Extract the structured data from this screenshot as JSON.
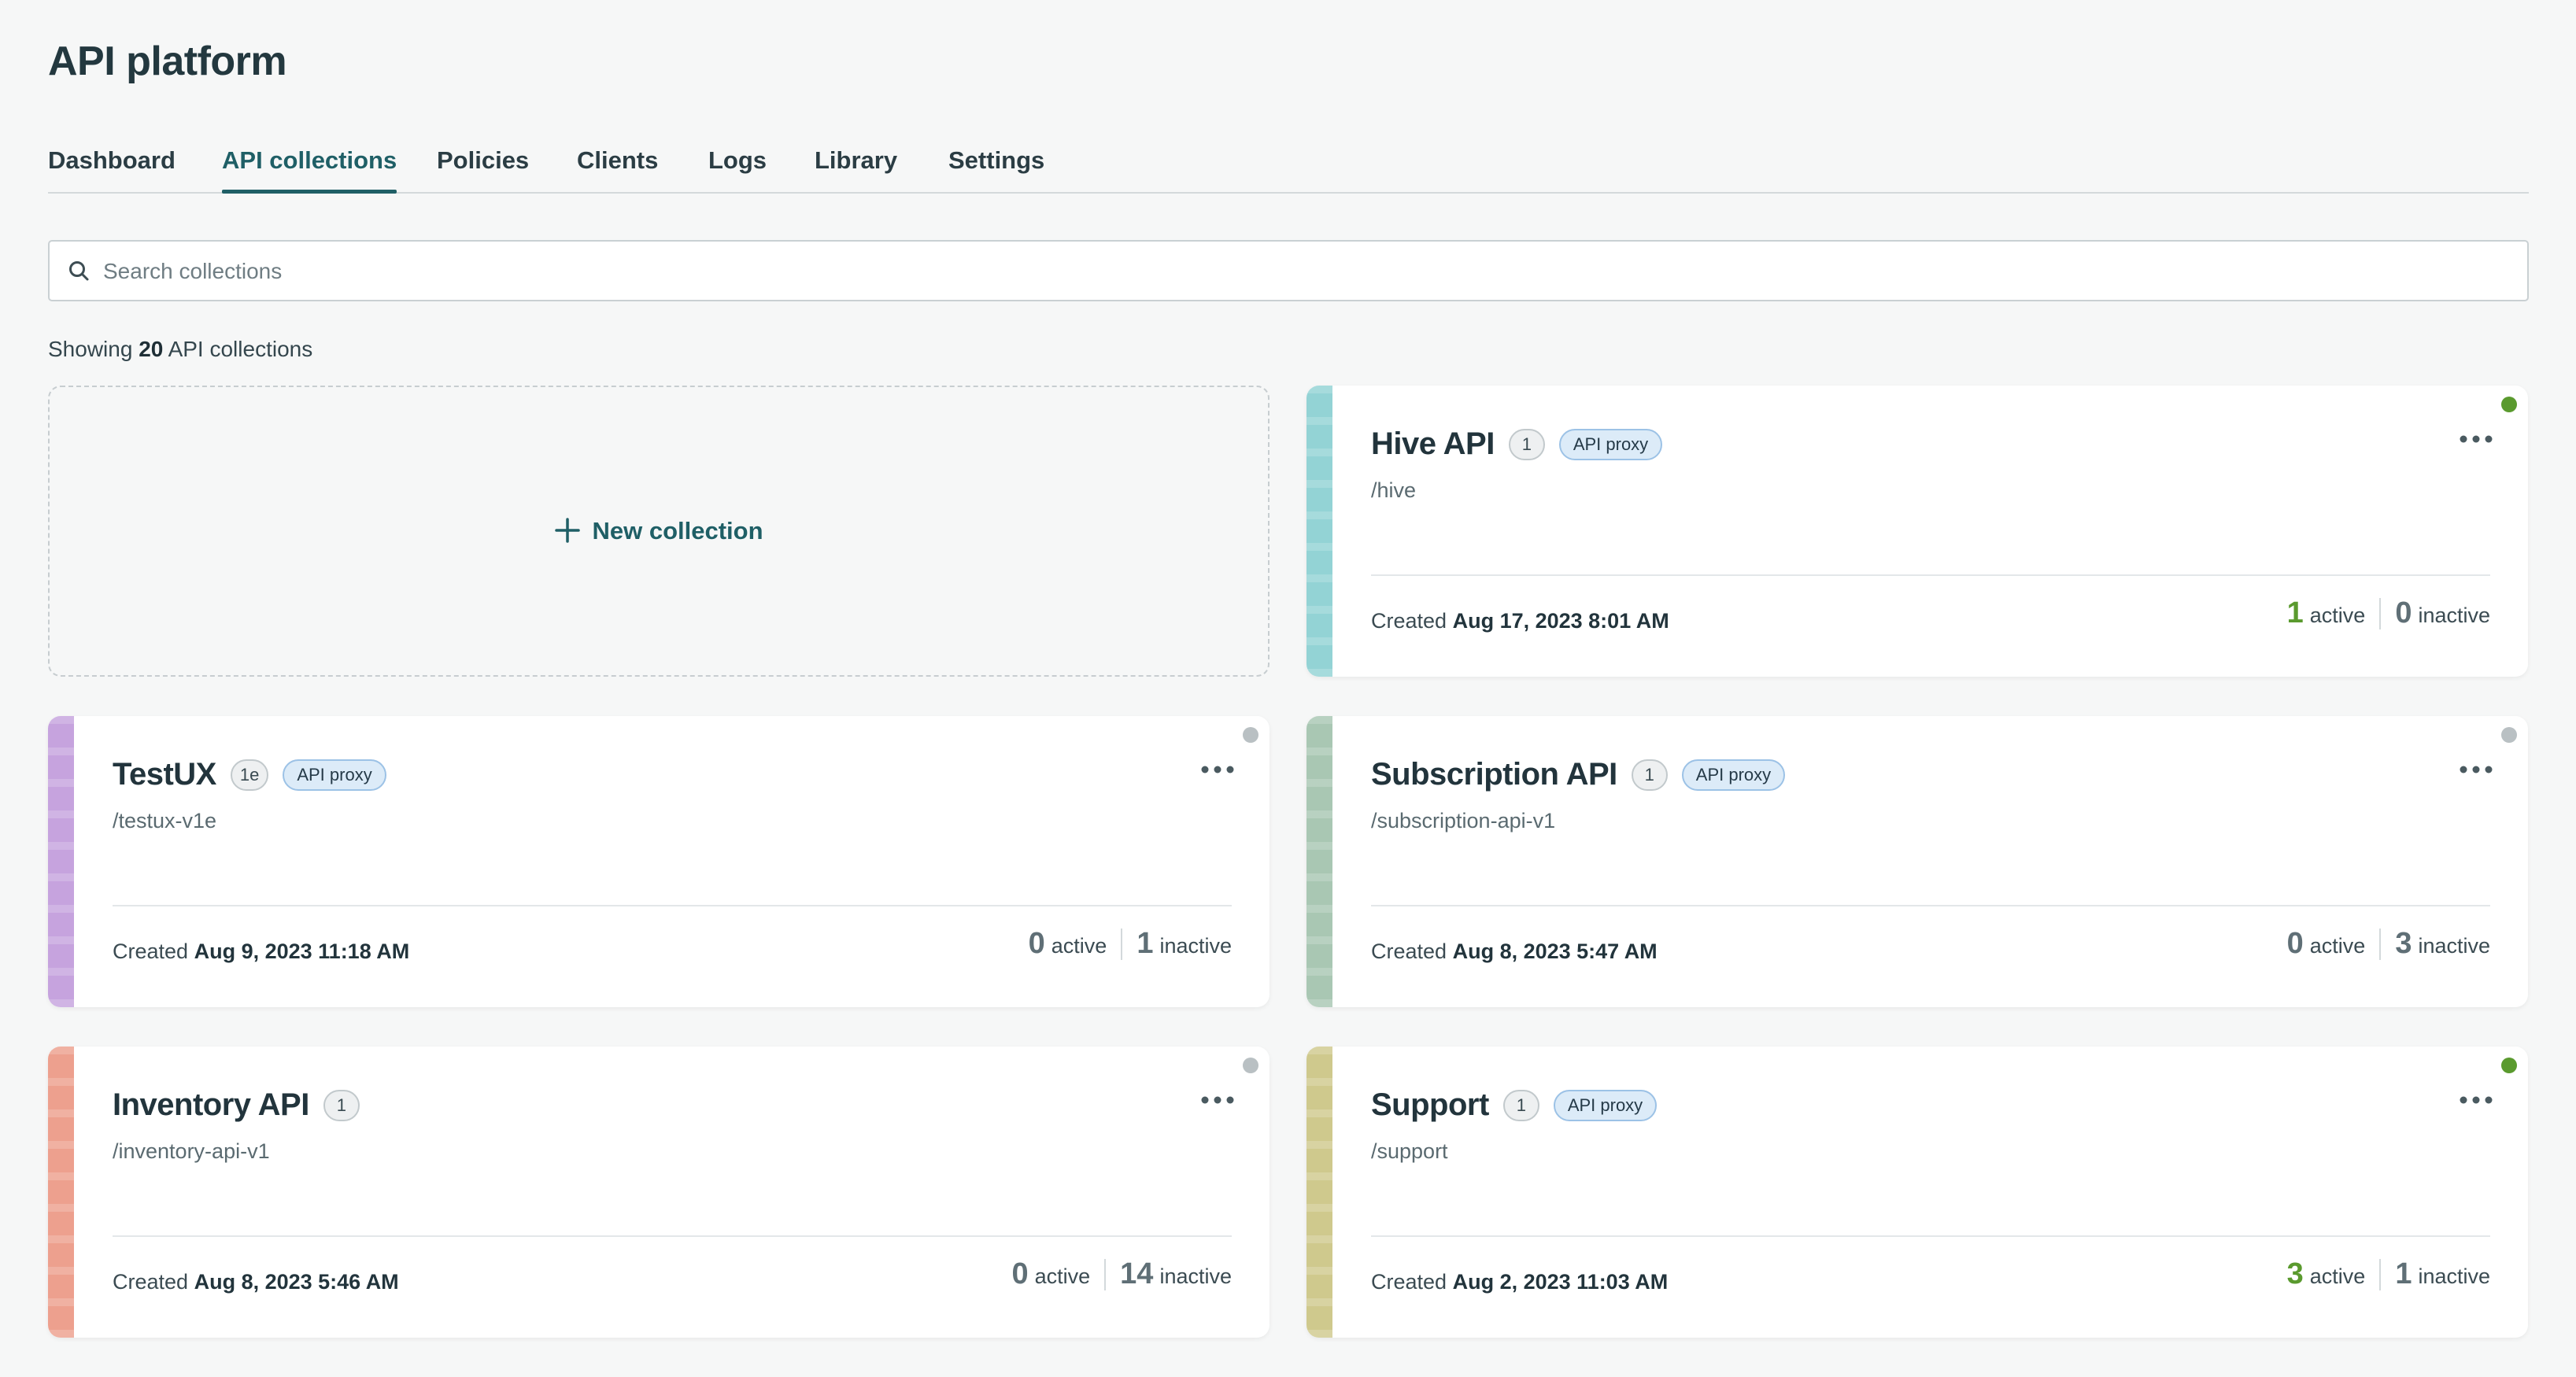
{
  "app": {
    "title": "API platform"
  },
  "tabs": [
    "Dashboard",
    "API collections",
    "Policies",
    "Clients",
    "Logs",
    "Library",
    "Settings"
  ],
  "active_tab": "API collections",
  "search": {
    "placeholder": "Search collections",
    "value": ""
  },
  "summary": {
    "prefix": "Showing",
    "count": "20",
    "suffix": "API collections"
  },
  "new_collection_label": "New collection",
  "labels": {
    "created": "Created",
    "active": "active",
    "inactive": "inactive"
  },
  "colors": {
    "accent": "#1f5f66",
    "status_active": "#5a9a2e",
    "status_inactive": "#b9c0c3"
  },
  "collections": [
    {
      "name": "Hive API",
      "version": "1",
      "type": "API proxy",
      "path": "/hive",
      "created": "Aug 17, 2023 8:01 AM",
      "active": "1",
      "inactive": "0",
      "status": "active",
      "stripe_color": "#93d3d5"
    },
    {
      "name": "TestUX",
      "version": "1e",
      "type": "API proxy",
      "path": "/testux-v1e",
      "created": "Aug 9, 2023 11:18 AM",
      "active": "0",
      "inactive": "1",
      "status": "inactive",
      "stripe_color": "#c6a3de"
    },
    {
      "name": "Subscription API",
      "version": "1",
      "type": "API proxy",
      "path": "/subscription-api-v1",
      "created": "Aug 8, 2023 5:47 AM",
      "active": "0",
      "inactive": "3",
      "status": "inactive",
      "stripe_color": "#a9c7b3"
    },
    {
      "name": "Inventory API",
      "version": "1",
      "type": "",
      "path": "/inventory-api-v1",
      "created": "Aug 8, 2023 5:46 AM",
      "active": "0",
      "inactive": "14",
      "status": "inactive",
      "stripe_color": "#eda08e"
    },
    {
      "name": "Support",
      "version": "1",
      "type": "API proxy",
      "path": "/support",
      "created": "Aug 2, 2023 11:03 AM",
      "active": "3",
      "inactive": "1",
      "status": "active",
      "stripe_color": "#cfc98d"
    }
  ]
}
